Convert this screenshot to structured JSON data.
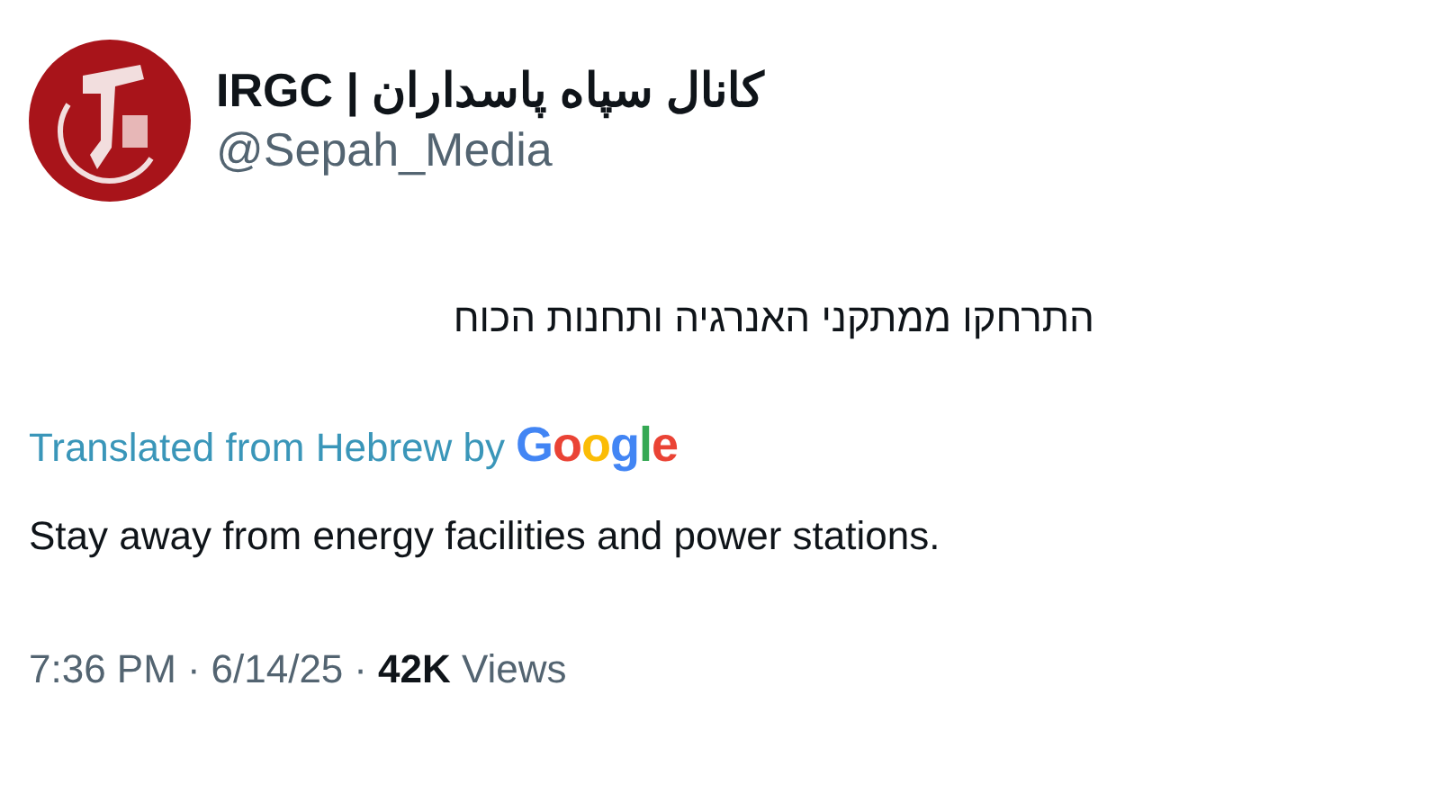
{
  "author": {
    "name": "کانال سپاه پاسداران | IRGC",
    "handle": "@Sepah_Media"
  },
  "tweet": {
    "text": "התרחקו ממתקני האנרגיה ותחנות הכוח"
  },
  "translation": {
    "label": "Translated from Hebrew by",
    "provider": "Google",
    "text": "Stay away from energy facilities and power stations."
  },
  "footer": {
    "time": "7:36 PM",
    "separator_1": "·",
    "date": "6/14/25",
    "separator_2": "·",
    "views_count": "42K",
    "views_label": "Views"
  }
}
